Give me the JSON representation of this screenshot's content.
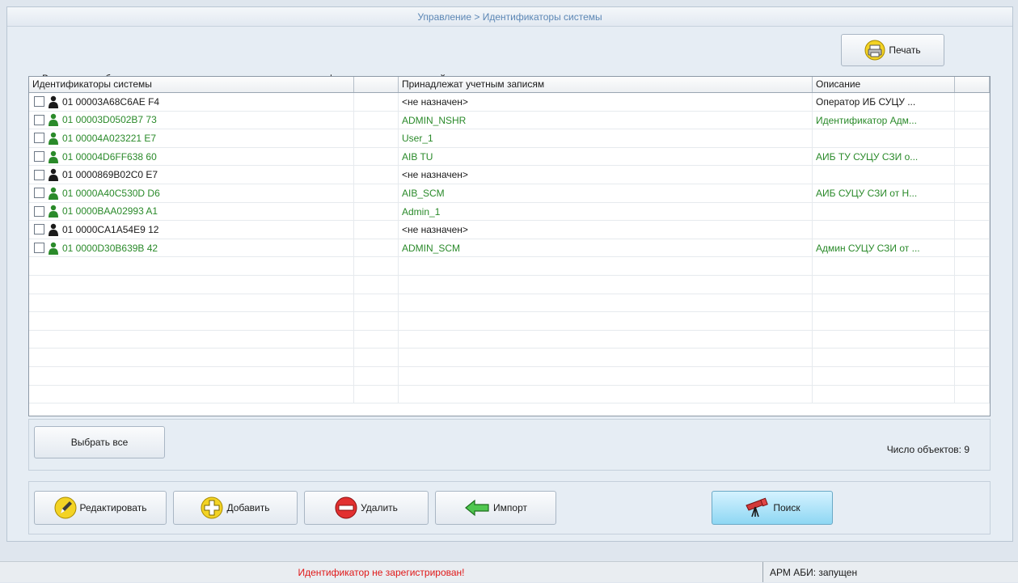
{
  "breadcrumb": "Управление > Идентификаторы системы",
  "description": "Вы можете добавлять, удалять и редактировать список идентификаторов пользователей системы",
  "print_button": "Печать",
  "columns": {
    "identifiers": "Идентификаторы системы",
    "blank": "",
    "accounts": "Принадлежат учетным записям",
    "description": "Описание",
    "extra": ""
  },
  "rows": [
    {
      "id": "01 00003A68C6AE F4",
      "account": "<не назначен>",
      "desc": "Оператор ИБ СУЦУ ...",
      "status": "black"
    },
    {
      "id": "01 00003D0502B7 73",
      "account": "ADMIN_NSHR",
      "desc": "Идентификатор Адм...",
      "status": "green"
    },
    {
      "id": "01 00004A023221 E7",
      "account": "User_1",
      "desc": "",
      "status": "green"
    },
    {
      "id": "01 00004D6FF638 60",
      "account": "AIB TU",
      "desc": "АИБ ТУ СУЦУ СЗИ о...",
      "status": "green"
    },
    {
      "id": "01 0000869B02C0 E7",
      "account": "<не назначен>",
      "desc": "",
      "status": "black"
    },
    {
      "id": "01 0000A40C530D D6",
      "account": "AIB_SCM",
      "desc": "АИБ СУЦУ СЗИ от Н...",
      "status": "green"
    },
    {
      "id": "01 0000BAA02993 A1",
      "account": "Admin_1",
      "desc": "",
      "status": "green"
    },
    {
      "id": "01 0000CA1A54E9 12",
      "account": "<не назначен>",
      "desc": "",
      "status": "black"
    },
    {
      "id": "01 0000D30B639B 42",
      "account": "ADMIN_SCM",
      "desc": "Админ СУЦУ СЗИ от ...",
      "status": "green"
    }
  ],
  "select_all_button": "Выбрать все",
  "object_count": "Число объектов: 9",
  "actions": {
    "edit": "Редактировать",
    "add": "Добавить",
    "delete": "Удалить",
    "import": "Импорт",
    "search": "Поиск"
  },
  "status": {
    "message": "Идентификатор не зарегистрирован!",
    "arm": "АРМ АБИ: запущен"
  },
  "colors": {
    "assigned": "#2a8a2a",
    "unassigned": "#1a1a1a",
    "error": "#e01818",
    "breadcrumb": "#5c87b5"
  },
  "icons": {
    "print": "printer-icon",
    "edit": "pen-icon",
    "add": "plus-icon",
    "delete": "minus-icon",
    "import": "arrow-left-icon",
    "search": "telescope-icon",
    "user": "user-icon"
  }
}
